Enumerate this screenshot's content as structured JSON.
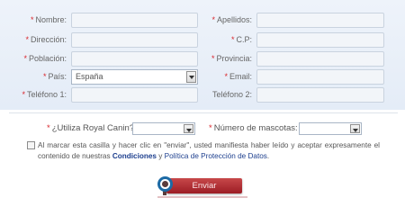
{
  "form": {
    "fields": {
      "nombre": {
        "label": "Nombre:",
        "required": true,
        "value": ""
      },
      "apellidos": {
        "label": "Apellidos:",
        "required": true,
        "value": ""
      },
      "direccion": {
        "label": "Dirección:",
        "required": true,
        "value": ""
      },
      "cp": {
        "label": "C.P:",
        "required": true,
        "value": ""
      },
      "poblacion": {
        "label": "Población:",
        "required": true,
        "value": ""
      },
      "provincia": {
        "label": "Provincia:",
        "required": true,
        "value": ""
      },
      "pais": {
        "label": "País:",
        "required": true,
        "value": "España"
      },
      "email": {
        "label": "Email:",
        "required": true,
        "value": ""
      },
      "telefono1": {
        "label": "Teléfono 1:",
        "required": true,
        "value": ""
      },
      "telefono2": {
        "label": "Teléfono 2:",
        "required": false,
        "value": ""
      }
    },
    "required_marker": "*"
  },
  "questions": {
    "royal_canin": {
      "label": "¿Utiliza Royal Canin?",
      "value": ""
    },
    "mascotas": {
      "label": "Número de mascotas:",
      "value": ""
    }
  },
  "legal": {
    "text_before": "Al marcar esta casilla y hacer clic en \"enviar\", usted manifiesta haber leído y aceptar expresamente el contenido de nuestras ",
    "link_condiciones": "Condiciones",
    "text_middle": " y ",
    "link_privacidad": "Política de Protección de Datos",
    "text_after": ".",
    "checked": false
  },
  "submit": {
    "label": "Enviar"
  },
  "colors": {
    "required": "#d9262c",
    "link": "#1d3f8e",
    "button": "#b3323a",
    "panel": "#e8eef8"
  },
  "icons": {
    "select_arrow": "chevron-down-icon",
    "submit_ring": "ring-icon"
  }
}
